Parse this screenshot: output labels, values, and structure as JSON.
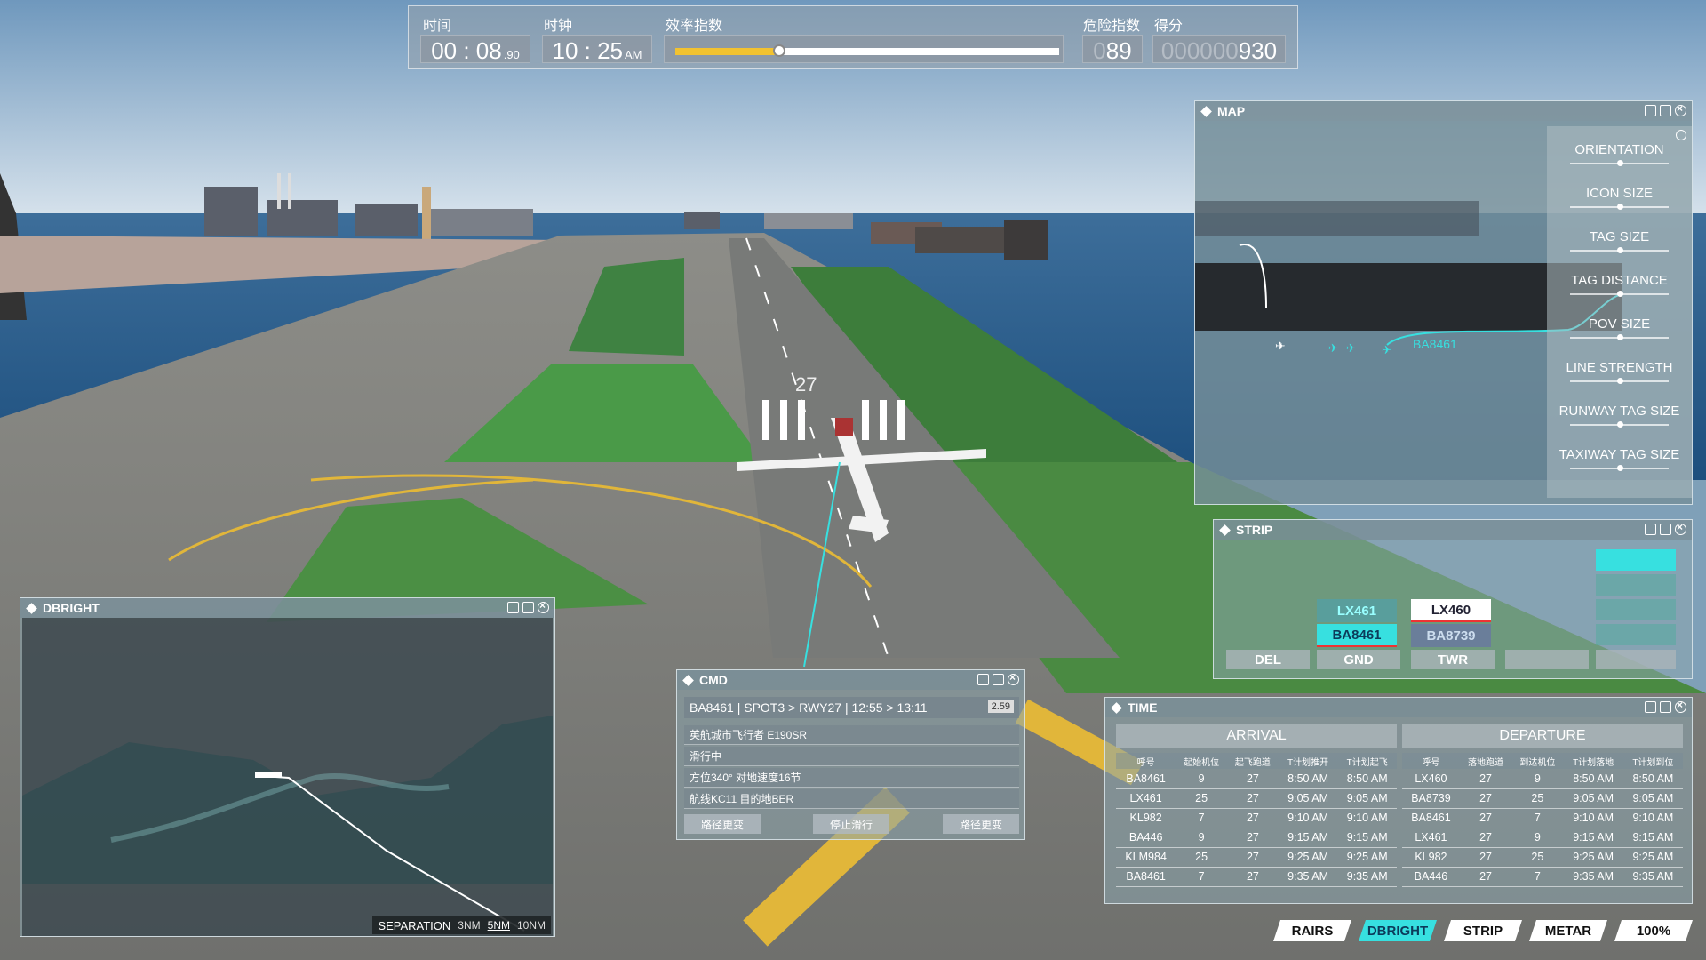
{
  "hud": {
    "time_label": "时间",
    "clock_label": "时钟",
    "efficiency_label": "效率指数",
    "danger_label": "危险指数",
    "score_label": "得分",
    "elapsed_main": "00 : 08",
    "elapsed_frac": ".90",
    "clock_main": "10 : 25",
    "clock_ampm": "AM",
    "efficiency_fraction": 0.27,
    "danger_dim": "0",
    "danger_value": "89",
    "score_dim": "000000",
    "score_value": "930"
  },
  "map_panel": {
    "title": "MAP",
    "callsign": "BA8461",
    "settings": [
      "ORIENTATION",
      "ICON SIZE",
      "TAG SIZE",
      "TAG DISTANCE",
      "POV SIZE",
      "LINE STRENGTH",
      "RUNWAY TAG SIZE",
      "TAXIWAY TAG SIZE"
    ]
  },
  "strip_panel": {
    "title": "STRIP",
    "bays": [
      "DEL",
      "GND",
      "TWR"
    ],
    "gnd_top": "LX461",
    "gnd_bottom": "BA8461",
    "twr_top": "LX460",
    "twr_bottom": "BA8739"
  },
  "time_panel": {
    "title": "TIME",
    "arrival": {
      "header": "ARRIVAL",
      "columns": [
        "呼号",
        "起始机位",
        "起飞跑道",
        "T计划推开",
        "T计划起飞"
      ],
      "rows": [
        [
          "BA8461",
          "9",
          "27",
          "8:50 AM",
          "8:50 AM"
        ],
        [
          "LX461",
          "25",
          "27",
          "9:05 AM",
          "9:05 AM"
        ],
        [
          "KL982",
          "7",
          "27",
          "9:10 AM",
          "9:10 AM"
        ],
        [
          "BA446",
          "9",
          "27",
          "9:15 AM",
          "9:15 AM"
        ],
        [
          "KLM984",
          "25",
          "27",
          "9:25 AM",
          "9:25 AM"
        ],
        [
          "BA8461",
          "7",
          "27",
          "9:35 AM",
          "9:35 AM"
        ]
      ]
    },
    "departure": {
      "header": "DEPARTURE",
      "columns": [
        "呼号",
        "落地跑道",
        "到达机位",
        "T计划落地",
        "T计划到位"
      ],
      "rows": [
        [
          "LX460",
          "27",
          "9",
          "8:50 AM",
          "8:50 AM"
        ],
        [
          "BA8739",
          "27",
          "25",
          "9:05 AM",
          "9:05 AM"
        ],
        [
          "BA8461",
          "27",
          "7",
          "9:10 AM",
          "9:10 AM"
        ],
        [
          "LX461",
          "27",
          "9",
          "9:15 AM",
          "9:15 AM"
        ],
        [
          "KL982",
          "27",
          "25",
          "9:25 AM",
          "9:25 AM"
        ],
        [
          "BA446",
          "27",
          "7",
          "9:35 AM",
          "9:35 AM"
        ]
      ]
    }
  },
  "cmd_panel": {
    "title": "CMD",
    "header_line": "BA8461 | SPOT3 > RWY27 | 12:55 > 13:11",
    "header_tag": "2.59",
    "lines": [
      "英航城市飞行者 E190SR",
      "滑行中",
      "方位340°  对地速度16节",
      "航线KC11  目的地BER"
    ],
    "buttons": [
      "路径更变",
      "停止滑行",
      "路径更变"
    ]
  },
  "dbright_panel": {
    "title": "DBRIGHT",
    "separation_label": "SEPARATION",
    "options": [
      "3NM",
      "5NM",
      "10NM"
    ],
    "selected": "5NM"
  },
  "scene": {
    "runway_number": "27"
  },
  "toolbar": {
    "items": [
      "RAIRS",
      "DBRIGHT",
      "STRIP",
      "METAR",
      "100%"
    ],
    "active": "DBRIGHT"
  },
  "colors": {
    "accent": "#37e0e0",
    "efficiency_bar": "#f2c230",
    "taxi_route": "#37e0e0"
  }
}
